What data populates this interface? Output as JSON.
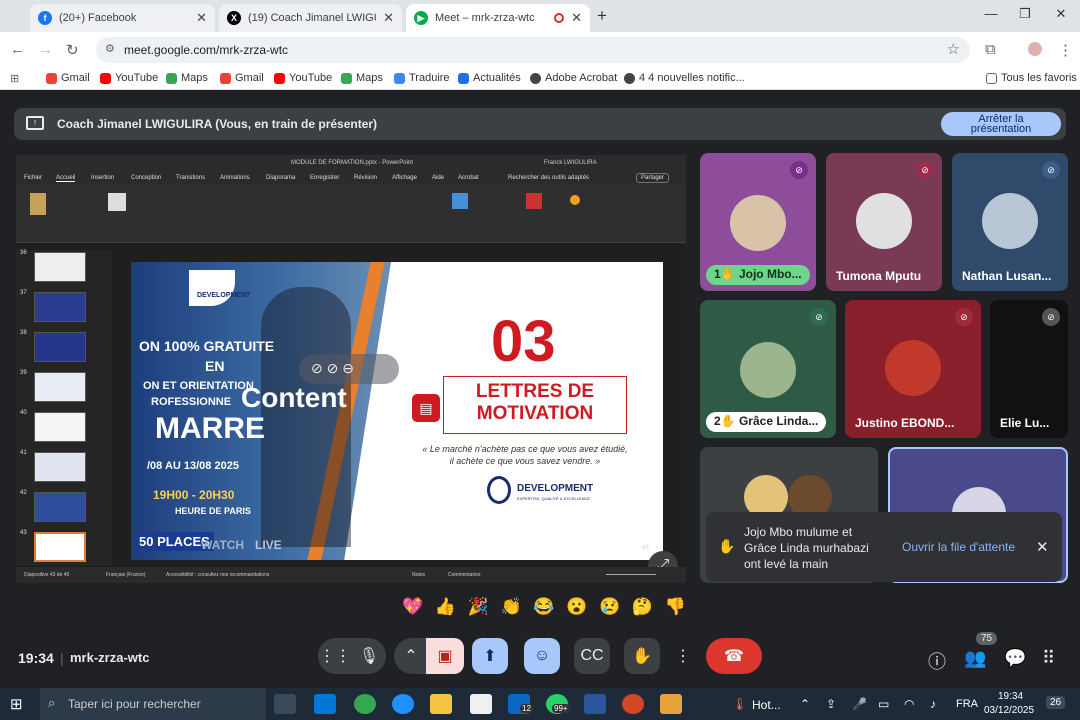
{
  "tabs": [
    {
      "title": "(20+) Facebook",
      "icon": "facebook-icon"
    },
    {
      "title": "(19) Coach Jimanel LWIGULIRA",
      "icon": "x-twitter-icon"
    },
    {
      "title": "Meet – mrk-zrza-wtc",
      "icon": "meet-icon"
    }
  ],
  "address": {
    "url": "meet.google.com/mrk-zrza-wtc"
  },
  "bookmarks": [
    "Gmail",
    "YouTube",
    "Maps",
    "Gmail",
    "YouTube",
    "Maps",
    "Traduire",
    "Actualités",
    "Adobe Acrobat",
    "4 4 nouvelles notific...",
    "Tous les favoris"
  ],
  "presenting": {
    "label": "Coach Jimanel LWIGULIRA (Vous, en train de présenter)",
    "stop_line1": "Arrêter la",
    "stop_line2": "présentation"
  },
  "ppt": {
    "title": "MODULE DE FORMATION.pptx - PowerPoint",
    "user": "Franck LWIGULIRA",
    "menu": [
      "Fichier",
      "Accueil",
      "Insertion",
      "Conception",
      "Transitions",
      "Animations",
      "Diaporama",
      "Enregistrer",
      "Révision",
      "Affichage",
      "Aide",
      "Acrobat"
    ],
    "search": "Rechercher des outils adaptés",
    "share": "Partager",
    "thumb_numbers": [
      "36",
      "37",
      "38",
      "39",
      "40",
      "41",
      "42",
      "43"
    ],
    "status_left": "Diapositive 43 de 45",
    "status_lang": "Français (France)",
    "status_access": "Accessibilité : consultez nos recommandations",
    "notes": "Notes",
    "comments": "Commentaires"
  },
  "slide": {
    "number": "03",
    "heading1": "LETTRES DE",
    "heading2": "MOTIVATION",
    "quote1": "« Le marché n'achète pas ce que vous avez étudié,",
    "quote2": "il achète ce que vous savez vendre. »",
    "brand": "DEVELOPMENT",
    "brand_sub": "EXPERTISE, QUALITÉ & EXCELLENCE",
    "left_logo": "DEVELOPMENT",
    "left_line1": "ON 100% GRATUITE",
    "left_line2": "EN",
    "left_line3": "ON ET ORIENTATION",
    "left_line4": "ROFESSIONNE",
    "left_line5": "MARRE",
    "left_line6": "/08 AU 13/08 2025",
    "left_line7": "19H00 - 20H30",
    "left_line8": "HEURE DE PARIS",
    "left_line9": "50 PLACES",
    "watch": "WATCH",
    "live": "LIVE",
    "overlay": "Content",
    "page_num": "43"
  },
  "participants": [
    {
      "name": "Jojo Mbo...",
      "badge": "1",
      "bg": "#8e4d9a"
    },
    {
      "name": "Tumona Mputu",
      "bg": "#7a3a55"
    },
    {
      "name": "Nathan Lusan...",
      "bg": "#2f4a6b"
    },
    {
      "name": "Grâce Linda...",
      "badge": "2",
      "bg": "#2e5a46"
    },
    {
      "name": "Justino EBOND...",
      "bg": "#8a1f2c"
    },
    {
      "name": "Elie Lu...",
      "bg": "#111111"
    }
  ],
  "notification": {
    "line1": "Jojo Mbo mulume et",
    "line2": "Grâce Linda murhabazi",
    "line3": "ont levé la main",
    "action": "Ouvrir la file d'attente"
  },
  "reactions": [
    "💖",
    "👍",
    "🎉",
    "👏",
    "😂",
    "😮",
    "😢",
    "🤔",
    "👎"
  ],
  "meeting": {
    "time": "19:34",
    "code": "mrk-zrza-wtc",
    "people_count": "75"
  },
  "taskbar": {
    "search": "Taper ici pour rechercher",
    "linkedin_badge": "12",
    "whatsapp_badge": "99+",
    "weather": "Hot...",
    "lang": "FRA",
    "time": "19:34",
    "date": "03/12/2025",
    "notif": "26"
  }
}
